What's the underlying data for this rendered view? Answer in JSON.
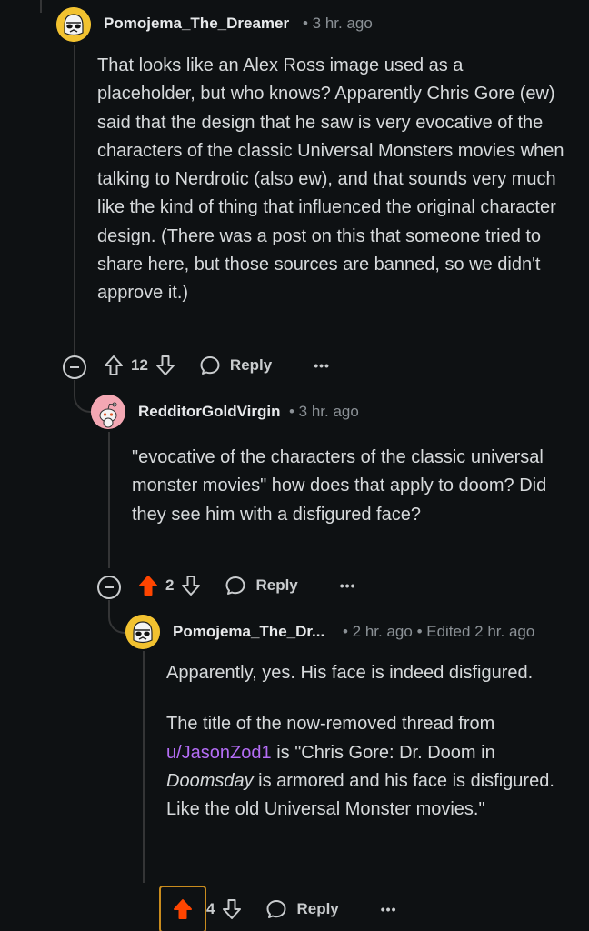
{
  "comments": [
    {
      "username": "Pomojema_The_Dreamer",
      "meta": "• 3 hr. ago",
      "avatar": "stormtrooper-avatar",
      "paragraphs": [
        "That looks like an Alex Ross image used as a placeholder, but who knows? Apparently Chris Gore (ew) said that the design that he saw is very evocative of the characters of the classic Universal Monsters movies when talking to Nerdrotic (also ew), and that sounds very much like the kind of thing that influenced the original character design. (There was a post on this that someone tried to share here, but those sources are banned, so we didn't approve it.)"
      ],
      "votes": "12",
      "upvoted": false,
      "reply_label": "Reply",
      "more_label": "•••"
    },
    {
      "username": "RedditorGoldVirgin",
      "meta": "• 3 hr. ago",
      "avatar": "snoo-avatar",
      "paragraphs": [
        "\"evocative of the characters of the classic universal monster movies\" how does that apply to doom? Did they see him with a disfigured face?"
      ],
      "votes": "2",
      "upvoted": true,
      "reply_label": "Reply",
      "more_label": "•••"
    },
    {
      "username": "Pomojema_The_Dr...",
      "meta": "• 2 hr. ago • Edited 2 hr. ago",
      "avatar": "stormtrooper-avatar",
      "paragraph1": "Apparently, yes. His face is indeed disfigured.",
      "p2_before": "The title of the now-removed thread from ",
      "p2_user": "u/JasonZod1",
      "p2_mid": " is \"Chris Gore: Dr. Doom in ",
      "p2_italic": "Doomsday",
      "p2_after": " is armored and his face is disfigured. Like the old Universal Monster movies.\"",
      "votes": "4",
      "upvoted": true,
      "reply_label": "Reply",
      "more_label": "•••"
    }
  ],
  "colors": {
    "background": "#0e1113",
    "upvote_active": "#ff4500",
    "user_link": "#b46df5",
    "meta_text": "#8b9196",
    "thread_line": "#343536"
  }
}
